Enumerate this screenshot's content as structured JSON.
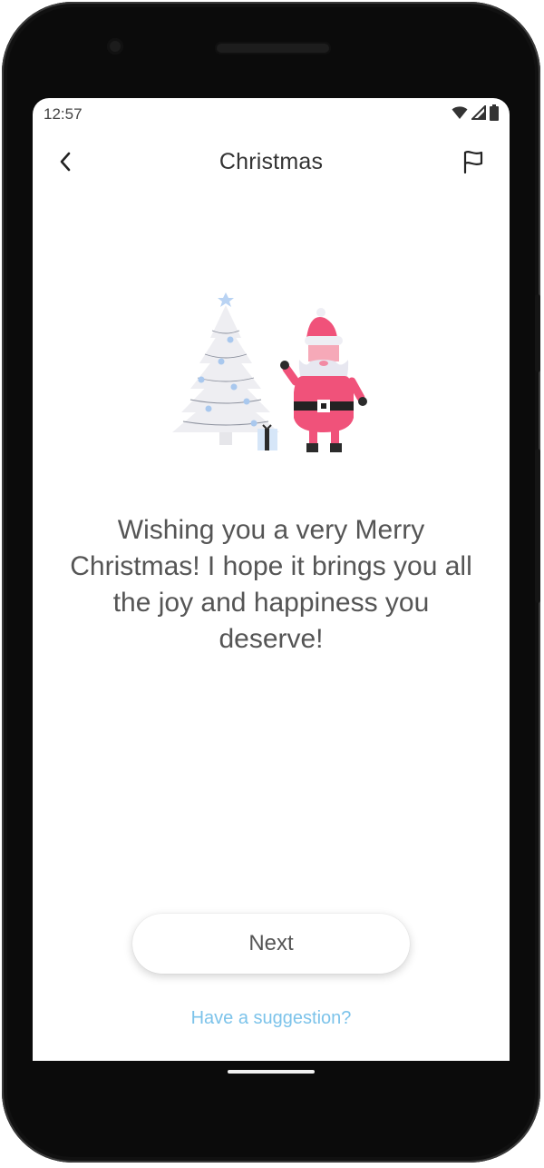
{
  "status_bar": {
    "time": "12:57",
    "icons": [
      "wifi-icon",
      "signal-icon",
      "battery-icon"
    ]
  },
  "app_bar": {
    "title": "Christmas",
    "back_icon": "chevron-left-icon",
    "report_icon": "flag-icon"
  },
  "illustration": {
    "subject": "christmas-tree-and-santa",
    "colors": {
      "santa_red": "#f0527a",
      "tree": "#eeeef2",
      "ornaments": "#a9c8ee",
      "belt": "#222222"
    }
  },
  "message": {
    "text": "Wishing you a very Merry Christmas! I hope it brings you all the joy and happiness you deserve!"
  },
  "actions": {
    "next_label": "Next",
    "suggestion_label": "Have a suggestion?"
  },
  "theme": {
    "accent_link": "#7cc3ea",
    "text": "#555555"
  }
}
